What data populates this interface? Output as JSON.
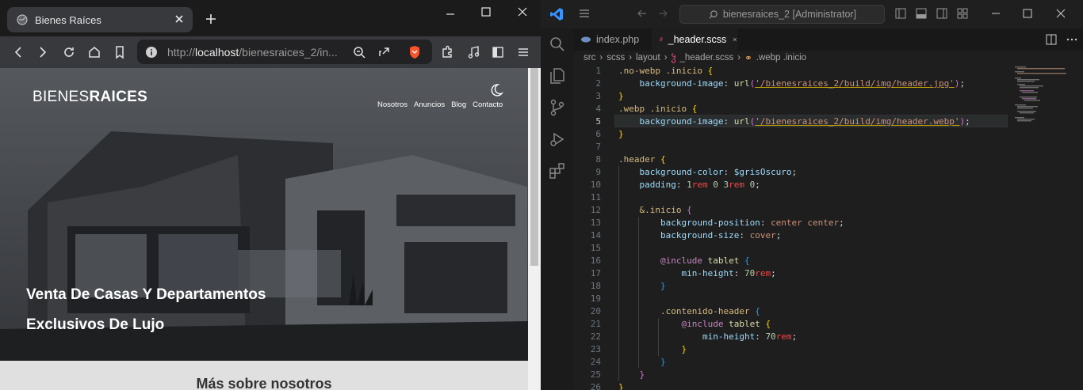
{
  "browser": {
    "tab_title": "Bienes Raíces",
    "url_host": "localhost",
    "url_prefix": "http://",
    "url_path": "/bienesraices_2/in..."
  },
  "site": {
    "logo_light": "BIENES",
    "logo_bold": "RAICES",
    "nav": [
      "Nosotros",
      "Anuncios",
      "Blog",
      "Contacto"
    ],
    "hero_line1": "Venta De Casas Y Departamentos",
    "hero_line2": "Exclusivos De Lujo",
    "section_title": "Más sobre nosotros"
  },
  "vscode": {
    "search": "bienesraices_2 [Administrator]",
    "tabs": [
      {
        "label": "index.php",
        "active": false
      },
      {
        "label": "_header.scss",
        "active": true
      }
    ],
    "breadcrumb": [
      "src",
      "scss",
      "layout",
      "_header.scss",
      ".webp .inicio"
    ],
    "current_line": 5,
    "line_numbers": [
      "1",
      "2",
      "3",
      "4",
      "5",
      "6",
      "7",
      "8",
      "9",
      "10",
      "11",
      "12",
      "13",
      "14",
      "15",
      "16",
      "17",
      "18",
      "19",
      "20",
      "21",
      "22",
      "23",
      "24",
      "25",
      "26"
    ],
    "code": [
      [
        {
          "t": ".no-webp .inicio ",
          "c": "#d7ba7d"
        },
        {
          "t": "{",
          "c": "#ffd700"
        }
      ],
      [
        {
          "t": "    background-image",
          "c": "#9cdcfe"
        },
        {
          "t": ": ",
          "c": "#d4d4d4"
        },
        {
          "t": "url",
          "c": "#dcdcaa"
        },
        {
          "t": "(",
          "c": "#da70d6"
        },
        {
          "t": "'/bienesraices_2/build/img/header.jpg'",
          "c": "#ce9178"
        },
        {
          "t": ")",
          "c": "#da70d6"
        },
        {
          "t": ";",
          "c": "#d4d4d4"
        }
      ],
      [
        {
          "t": "}",
          "c": "#ffd700"
        }
      ],
      [
        {
          "t": ".webp .inicio ",
          "c": "#d7ba7d"
        },
        {
          "t": "{",
          "c": "#ffd700"
        }
      ],
      [
        {
          "t": "    background-image",
          "c": "#9cdcfe"
        },
        {
          "t": ": ",
          "c": "#d4d4d4"
        },
        {
          "t": "url",
          "c": "#dcdcaa"
        },
        {
          "t": "(",
          "c": "#da70d6"
        },
        {
          "t": "'/bienesraices_2/build/img/header.webp'",
          "c": "#ce9178"
        },
        {
          "t": ")",
          "c": "#da70d6"
        },
        {
          "t": ";",
          "c": "#d4d4d4"
        }
      ],
      [
        {
          "t": "}",
          "c": "#ffd700"
        }
      ],
      [],
      [
        {
          "t": ".header ",
          "c": "#d7ba7d"
        },
        {
          "t": "{",
          "c": "#ffd700"
        }
      ],
      [
        {
          "t": "    background-color",
          "c": "#9cdcfe"
        },
        {
          "t": ": ",
          "c": "#d4d4d4"
        },
        {
          "t": "$grisOscuro",
          "c": "#9cdcfe"
        },
        {
          "t": ";",
          "c": "#d4d4d4"
        }
      ],
      [
        {
          "t": "    padding",
          "c": "#9cdcfe"
        },
        {
          "t": ": ",
          "c": "#d4d4d4"
        },
        {
          "t": "1",
          "c": "#b5cea8"
        },
        {
          "t": "rem",
          "c": "#f44747"
        },
        {
          "t": " 0 ",
          "c": "#b5cea8"
        },
        {
          "t": "3",
          "c": "#b5cea8"
        },
        {
          "t": "rem",
          "c": "#f44747"
        },
        {
          "t": " 0",
          "c": "#b5cea8"
        },
        {
          "t": ";",
          "c": "#d4d4d4"
        }
      ],
      [],
      [
        {
          "t": "    &.inicio ",
          "c": "#d7ba7d"
        },
        {
          "t": "{",
          "c": "#da70d6"
        }
      ],
      [
        {
          "t": "        background-position",
          "c": "#9cdcfe"
        },
        {
          "t": ": ",
          "c": "#d4d4d4"
        },
        {
          "t": "center center",
          "c": "#ce9178"
        },
        {
          "t": ";",
          "c": "#d4d4d4"
        }
      ],
      [
        {
          "t": "        background-size",
          "c": "#9cdcfe"
        },
        {
          "t": ": ",
          "c": "#d4d4d4"
        },
        {
          "t": "cover",
          "c": "#ce9178"
        },
        {
          "t": ";",
          "c": "#d4d4d4"
        }
      ],
      [],
      [
        {
          "t": "        @include",
          "c": "#c586c0"
        },
        {
          "t": " tablet ",
          "c": "#dcdcaa"
        },
        {
          "t": "{",
          "c": "#179fff"
        }
      ],
      [
        {
          "t": "            min-height",
          "c": "#9cdcfe"
        },
        {
          "t": ": ",
          "c": "#d4d4d4"
        },
        {
          "t": "70",
          "c": "#b5cea8"
        },
        {
          "t": "rem",
          "c": "#f44747"
        },
        {
          "t": ";",
          "c": "#d4d4d4"
        }
      ],
      [
        {
          "t": "        }",
          "c": "#179fff"
        }
      ],
      [],
      [
        {
          "t": "        .contenido-header ",
          "c": "#d7ba7d"
        },
        {
          "t": "{",
          "c": "#179fff"
        }
      ],
      [
        {
          "t": "            @include",
          "c": "#c586c0"
        },
        {
          "t": " tablet ",
          "c": "#dcdcaa"
        },
        {
          "t": "{",
          "c": "#ffd700"
        }
      ],
      [
        {
          "t": "                min-height",
          "c": "#9cdcfe"
        },
        {
          "t": ": ",
          "c": "#d4d4d4"
        },
        {
          "t": "70",
          "c": "#b5cea8"
        },
        {
          "t": "rem",
          "c": "#f44747"
        },
        {
          "t": ";",
          "c": "#d4d4d4"
        }
      ],
      [
        {
          "t": "            }",
          "c": "#ffd700"
        }
      ],
      [
        {
          "t": "        }",
          "c": "#179fff"
        }
      ],
      [
        {
          "t": "    }",
          "c": "#da70d6"
        }
      ],
      [
        {
          "t": "}",
          "c": "#ffd700"
        }
      ]
    ]
  },
  "colors": {
    "accent": "#0078d4",
    "brave": "#fb542b",
    "vscode_blue": "#3794ff"
  }
}
